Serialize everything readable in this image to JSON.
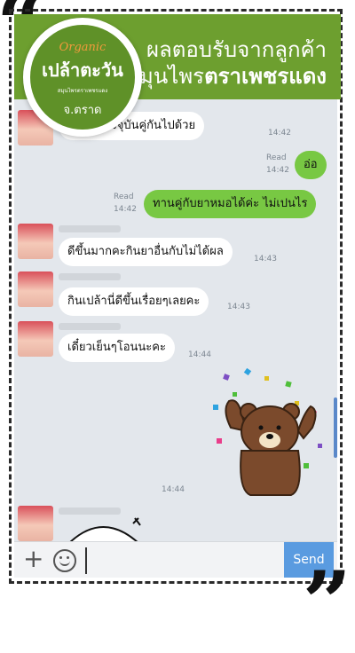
{
  "header": {
    "line1": "ผลตอบรับจากลูกค้า",
    "line2_prefix": "สมุนไพร",
    "line2_bold": "ตราเพชรแดง"
  },
  "logo": {
    "organic": "Organic",
    "name": "เปล้าตะวัน",
    "tagline": "สมุนไพรตราเพชรแดง",
    "city": "จ.ตราด"
  },
  "messages": [
    {
      "side": "in",
      "text": "ยาหมอปัจจุบันคู่กันไปด้วย",
      "time": "14:42"
    },
    {
      "side": "out",
      "text": "อ่อ",
      "read": "Read",
      "time": "14:42"
    },
    {
      "side": "out",
      "text": "ทานคู่กับยาหมอได้ค่ะ ไม่เปนไร",
      "read": "Read",
      "time": "14:42"
    },
    {
      "side": "in",
      "text": "ดีขึ้นมากคะกินยาอื่นกับไม่ได้ผล",
      "time": "14:43"
    },
    {
      "side": "in",
      "text": "กินเปล้านี่ดีขึ้นเรื่อยๆเลยคะ",
      "time": "14:43"
    },
    {
      "side": "in",
      "text": "เดี๋ยวเย็นๆโอนนะคะ",
      "time": "14:44"
    },
    {
      "side": "out",
      "sticker": "bear-sticker",
      "read": "",
      "time": "14:44"
    }
  ],
  "input": {
    "plus_icon": "plus-icon",
    "emoji_icon": "smiley-icon",
    "send_label": "Send"
  },
  "colors": {
    "header_green": "#6d9f2f",
    "bubble_green": "#78c843",
    "chat_bg": "#e3e7ec",
    "send_blue": "#5a9be0"
  }
}
